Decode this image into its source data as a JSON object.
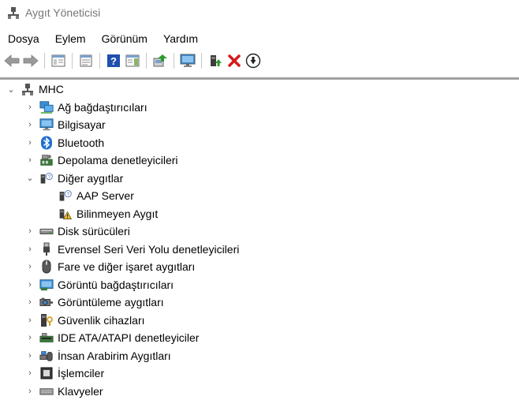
{
  "window": {
    "title": "Aygıt Yöneticisi"
  },
  "menu": [
    {
      "label": "Dosya"
    },
    {
      "label": "Eylem"
    },
    {
      "label": "Görünüm"
    },
    {
      "label": "Yardım"
    }
  ],
  "toolbar": {
    "buttons": [
      {
        "icon": "back-arrow-icon"
      },
      {
        "icon": "forward-arrow-icon"
      },
      {
        "icon": "show-hide-console-tree-icon"
      },
      {
        "icon": "properties-icon"
      },
      {
        "icon": "help-icon"
      },
      {
        "icon": "action-pane-icon"
      },
      {
        "icon": "update-driver-icon"
      },
      {
        "icon": "scan-hardware-icon"
      },
      {
        "icon": "enable-device-icon"
      },
      {
        "icon": "uninstall-device-icon"
      },
      {
        "icon": "download-icon"
      }
    ]
  },
  "tree": {
    "root": {
      "label": "MHC",
      "expanded": true
    },
    "items": [
      {
        "label": "Ağ bağdaştırıcıları",
        "icon": "network-adapter-icon",
        "expanded": false
      },
      {
        "label": "Bilgisayar",
        "icon": "computer-icon",
        "expanded": false
      },
      {
        "label": "Bluetooth",
        "icon": "bluetooth-icon",
        "expanded": false
      },
      {
        "label": "Depolama denetleyicileri",
        "icon": "storage-controller-icon",
        "expanded": false
      },
      {
        "label": "Diğer aygıtlar",
        "icon": "other-devices-icon",
        "expanded": true,
        "children": [
          {
            "label": "AAP Server",
            "icon": "unknown-device-icon"
          },
          {
            "label": "Bilinmeyen Aygıt",
            "icon": "warning-device-icon"
          }
        ]
      },
      {
        "label": "Disk sürücüleri",
        "icon": "disk-drive-icon",
        "expanded": false
      },
      {
        "label": "Evrensel Seri Veri Yolu denetleyicileri",
        "icon": "usb-icon",
        "expanded": false
      },
      {
        "label": "Fare ve diğer işaret aygıtları",
        "icon": "mouse-icon",
        "expanded": false
      },
      {
        "label": "Görüntü bağdaştırıcıları",
        "icon": "display-adapter-icon",
        "expanded": false
      },
      {
        "label": "Görüntüleme aygıtları",
        "icon": "camera-icon",
        "expanded": false
      },
      {
        "label": "Güvenlik cihazları",
        "icon": "security-device-icon",
        "expanded": false
      },
      {
        "label": "IDE ATA/ATAPI denetleyiciler",
        "icon": "ide-controller-icon",
        "expanded": false
      },
      {
        "label": "İnsan Arabirim Aygıtları",
        "icon": "hid-icon",
        "expanded": false
      },
      {
        "label": "İşlemciler",
        "icon": "processor-icon",
        "expanded": false
      },
      {
        "label": "Klavyeler",
        "icon": "keyboard-icon",
        "expanded": false
      }
    ]
  },
  "colors": {
    "delete_red": "#d41a1a",
    "enable_green": "#2d9a2d",
    "help_blue": "#1f4fb0",
    "monitor_blue": "#3a8ed8"
  }
}
